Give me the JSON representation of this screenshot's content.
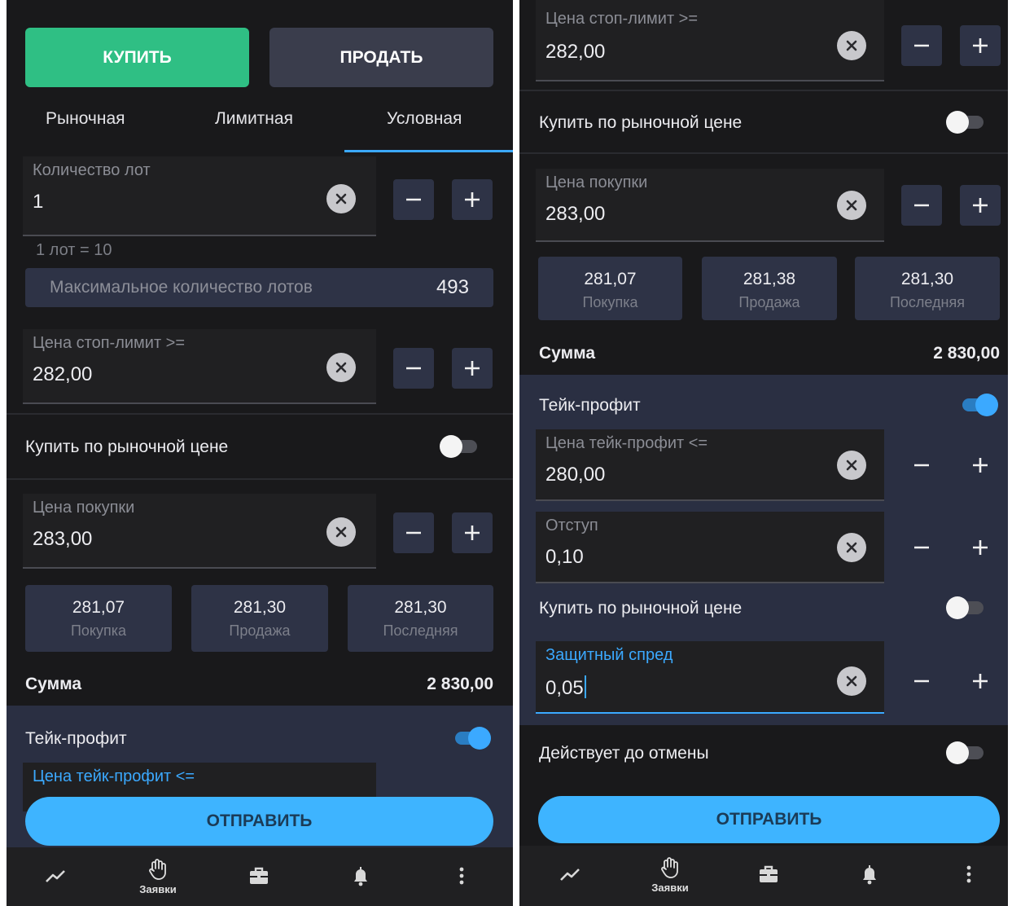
{
  "left": {
    "buy_label": "КУПИТЬ",
    "sell_label": "ПРОДАТЬ",
    "tabs": [
      {
        "label": "Рыночная"
      },
      {
        "label": "Лимитная"
      },
      {
        "label": "Условная"
      }
    ],
    "active_tab": "Условная",
    "lots": {
      "label": "Количество лот",
      "value": "1"
    },
    "lot_hint": "1 лот = 10",
    "max_lots": {
      "label": "Максимальное количество лотов",
      "value": "493"
    },
    "stop_limit": {
      "label": "Цена стоп-лимит >=",
      "value": "282,00"
    },
    "market_toggle": {
      "label": "Купить по рыночной цене",
      "on": false
    },
    "buy_price": {
      "label": "Цена покупки",
      "value": "283,00"
    },
    "quotes": [
      {
        "value": "281,07",
        "label": "Покупка"
      },
      {
        "value": "281,30",
        "label": "Продажа"
      },
      {
        "value": "281,30",
        "label": "Последняя"
      }
    ],
    "sum": {
      "label": "Сумма",
      "value": "2 830,00"
    },
    "take_profit": {
      "label": "Тейк-профит",
      "on": true
    },
    "tp_price_label": "Цена тейк-профит <=",
    "send_label": "ОТПРАВИТЬ"
  },
  "right": {
    "stop_limit": {
      "label": "Цена стоп-лимит >=",
      "value": "282,00"
    },
    "market_toggle": {
      "label": "Купить по рыночной цене",
      "on": false
    },
    "buy_price": {
      "label": "Цена покупки",
      "value": "283,00"
    },
    "quotes": [
      {
        "value": "281,07",
        "label": "Покупка"
      },
      {
        "value": "281,38",
        "label": "Продажа"
      },
      {
        "value": "281,30",
        "label": "Последняя"
      }
    ],
    "sum": {
      "label": "Сумма",
      "value": "2 830,00"
    },
    "take_profit": {
      "label": "Тейк-профит",
      "on": true
    },
    "tp_price": {
      "label": "Цена тейк-профит <=",
      "value": "280,00"
    },
    "offset": {
      "label": "Отступ",
      "value": "0,10"
    },
    "tp_market_toggle": {
      "label": "Купить по рыночной цене",
      "on": false
    },
    "spread": {
      "label": "Защитный спред",
      "value": "0,05"
    },
    "gtc_toggle": {
      "label": "Действует до отмены",
      "on": false
    },
    "send_label": "ОТПРАВИТЬ"
  },
  "nav": {
    "items": [
      {
        "icon": "chart-line-icon",
        "label": ""
      },
      {
        "icon": "hand-icon",
        "label": "Заявки"
      },
      {
        "icon": "briefcase-icon",
        "label": ""
      },
      {
        "icon": "bell-icon",
        "label": ""
      },
      {
        "icon": "more-vertical-icon",
        "label": ""
      }
    ]
  },
  "colors": {
    "background": "#19191b",
    "buy": "#2fbf84",
    "accent": "#3ba9ff",
    "panel": "#2e3346"
  }
}
